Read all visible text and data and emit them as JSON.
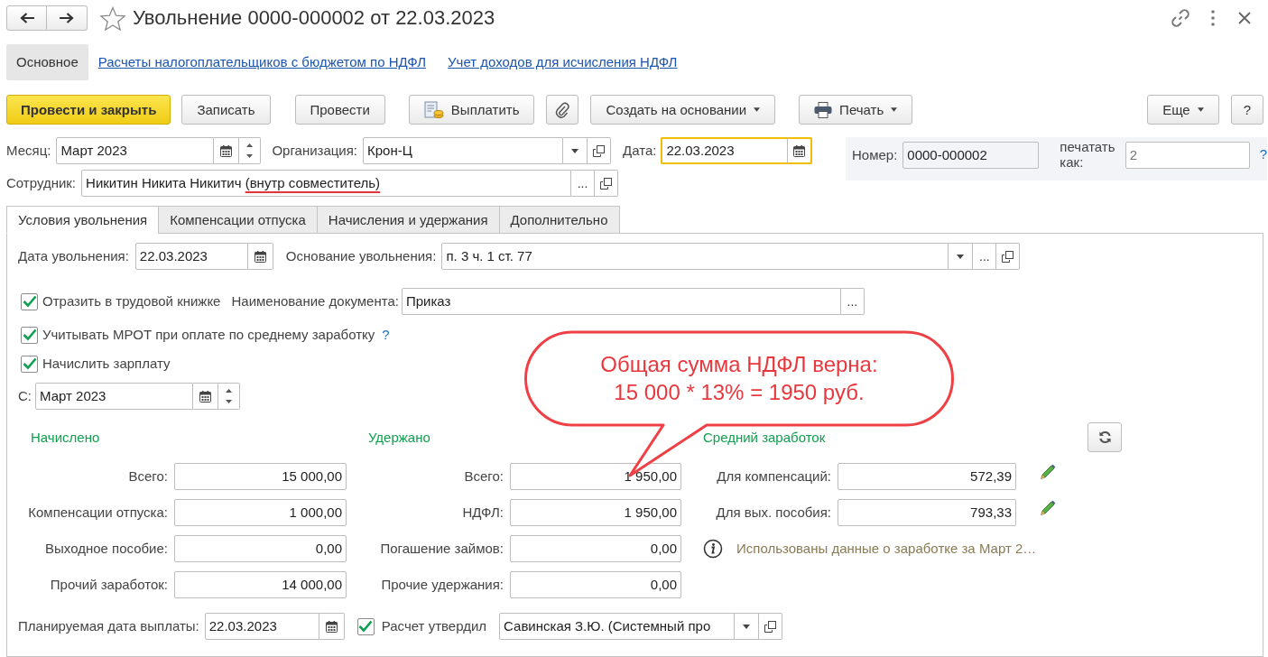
{
  "window": {
    "title": "Увольнение 0000-000002 от 22.03.2023"
  },
  "section_tabs": [
    {
      "label": "Основное",
      "selected": true
    },
    {
      "label": "Расчеты налогоплательщиков с бюджетом по НДФЛ",
      "selected": false
    },
    {
      "label": "Учет доходов для исчисления НДФЛ",
      "selected": false
    }
  ],
  "toolbar": [
    {
      "kind": "primary",
      "label": "Провести и закрыть"
    },
    {
      "kind": "plain",
      "label": "Записать"
    },
    {
      "kind": "plain",
      "label": "Провести"
    },
    {
      "kind": "pay",
      "label": "Выплатить"
    },
    {
      "kind": "attach"
    },
    {
      "kind": "menu",
      "label": "Создать на основании"
    },
    {
      "kind": "print",
      "label": "Печать"
    },
    {
      "kind": "menu",
      "label": "Еще"
    },
    {
      "kind": "plain",
      "label": "?"
    }
  ],
  "month": {
    "label": "Месяц:",
    "value": "Март 2023",
    "buttons": [
      {
        "kind": "calendar"
      },
      {
        "kind": "spin"
      }
    ]
  },
  "organization": {
    "label": "Организация:",
    "value": "Крон-Ц",
    "buttons": [
      {
        "kind": "dropdown"
      },
      {
        "kind": "open"
      }
    ]
  },
  "date": {
    "label": "Дата:",
    "value": "22.03.2023",
    "focused": true,
    "buttons": [
      {
        "kind": "calendar"
      }
    ]
  },
  "number": {
    "label": "Номер:",
    "value": "0000-000002",
    "readonly": true
  },
  "print_as": {
    "label": "печатать как:",
    "placeholder": "2",
    "help": "?"
  },
  "employee": {
    "label": "Сотрудник:",
    "value_parts": [
      {
        "text": "Никитин Никита Никитич ",
        "underlined": false
      },
      {
        "text": "(внутр совместитель)",
        "underlined": true
      }
    ],
    "buttons": [
      {
        "kind": "choose",
        "label": "..."
      },
      {
        "kind": "open"
      }
    ]
  },
  "form_tabs": [
    {
      "label": "Условия увольнения",
      "selected": true
    },
    {
      "label": "Компенсации отпуска",
      "selected": false
    },
    {
      "label": "Начисления и удержания",
      "selected": false
    },
    {
      "label": "Дополнительно",
      "selected": false
    }
  ],
  "dismissal_date": {
    "label": "Дата увольнения:",
    "value": "22.03.2023",
    "buttons": [
      {
        "kind": "calendar"
      }
    ]
  },
  "dismissal_reason": {
    "label": "Основание увольнения:",
    "value": "п. 3 ч. 1 ст. 77",
    "buttons": [
      {
        "kind": "dropdown"
      },
      {
        "kind": "choose",
        "label": "..."
      },
      {
        "kind": "open"
      }
    ]
  },
  "checks": [
    {
      "label": "Отразить в трудовой книжке",
      "checked": true
    },
    {
      "label": "Учитывать МРОТ при оплате по среднему заработку",
      "checked": true,
      "help": "?"
    },
    {
      "label": "Начислить зарплату",
      "checked": true
    }
  ],
  "document_name": {
    "label": "Наименование документа:",
    "value": "Приказ",
    "buttons": [
      {
        "kind": "choose",
        "label": "..."
      }
    ]
  },
  "from": {
    "label": "С:",
    "value": "Март 2023",
    "buttons": [
      {
        "kind": "calendar"
      },
      {
        "kind": "spin"
      }
    ]
  },
  "accrued": {
    "title": "Начислено",
    "rows": [
      {
        "label": "Всего:",
        "value": "15 000,00"
      },
      {
        "label": "Компенсации отпуска:",
        "value": "1 000,00"
      },
      {
        "label": "Выходное пособие:",
        "value": "0,00"
      },
      {
        "label": "Прочий заработок:",
        "value": "14 000,00"
      }
    ]
  },
  "withheld": {
    "title": "Удержано",
    "rows": [
      {
        "label": "Всего:",
        "value": "1 950,00"
      },
      {
        "label": "НДФЛ:",
        "value": "1 950,00"
      },
      {
        "label": "Погашение займов:",
        "value": "0,00"
      },
      {
        "label": "Прочие удержания:",
        "value": "0,00"
      }
    ]
  },
  "average": {
    "title": "Средний заработок",
    "rows": [
      {
        "label": "Для компенсаций:",
        "value": "572,39",
        "editable": true
      },
      {
        "label": "Для вых. пособия:",
        "value": "793,33",
        "editable": true
      }
    ],
    "note": "Использованы данные о заработке за Март 2…"
  },
  "payment_date": {
    "label": "Планируемая дата выплаты:",
    "value": "22.03.2023",
    "buttons": [
      {
        "kind": "calendar"
      }
    ]
  },
  "approved": {
    "label": "Расчет утвердил",
    "checked": true
  },
  "approver": {
    "value": "Савинская З.Ю. (Системный про",
    "buttons": [
      {
        "kind": "dropdown"
      },
      {
        "kind": "open"
      }
    ]
  },
  "callout": {
    "text": "Общая сумма НДФЛ верна:\n15 000 * 13% = 1950 руб."
  }
}
